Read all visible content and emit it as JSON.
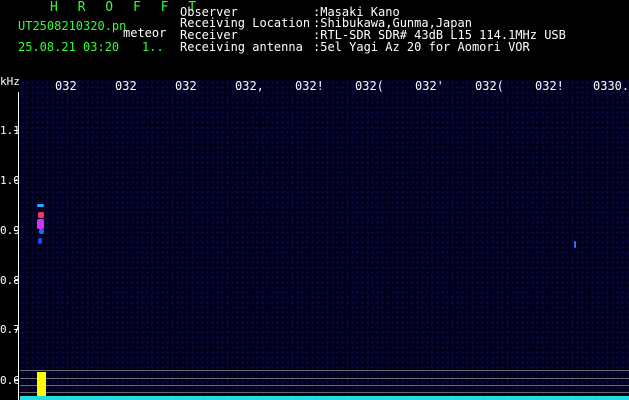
{
  "header": {
    "app_title": "H R O F F T",
    "filename": "UT2508210320.pn",
    "mode": "meteor",
    "datetime": "25.08.21 03:20",
    "extra": "1.."
  },
  "station": {
    "observer_label": "Observer",
    "observer_value": ":Masaki Kano",
    "location_label": "Receiving Location",
    "location_value": ":Shibukawa,Gunma,Japan",
    "receiver_label": "Receiver",
    "receiver_value": ":RTL-SDR SDR# 43dB L15 114.1MHz USB",
    "antenna_label": "Receiving antenna",
    "antenna_value": ":5el Yagi Az 20 for Aomori VOR"
  },
  "axis": {
    "y_unit": "kHz",
    "y_labels": [
      "1.1",
      "1.0",
      "0.9",
      "0.8",
      "0.7",
      "0.6"
    ],
    "x_labels": [
      "032",
      "032",
      "032",
      "032,",
      "032!",
      "032(",
      "032'",
      "032(",
      "032!",
      "0330."
    ]
  },
  "colors": {
    "background": "#000000",
    "plot_noise": "#0a0a55",
    "header_green": "#33ff33",
    "trace_cyan": "#22dddd",
    "echo_yellow": "#ffff00"
  }
}
